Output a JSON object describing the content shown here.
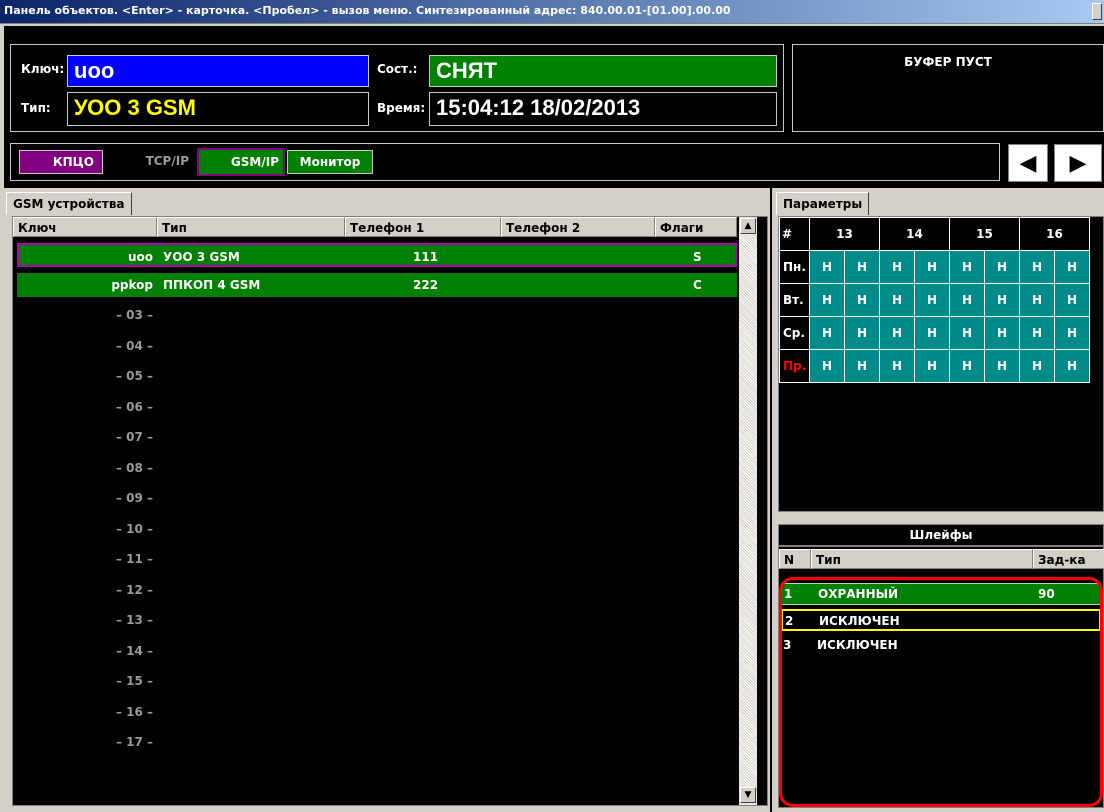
{
  "window": {
    "title": "Панель объектов. <Enter> - карточка. <Пробел> - вызов меню. Синтезированный адрес: 840.00.01-[01.00].00.00"
  },
  "header": {
    "key_label": "Ключ:",
    "key_value": "uoo",
    "type_label": "Тип:",
    "type_value": "УОО 3 GSM",
    "state_label": "Сост.:",
    "state_value": "СНЯТ",
    "time_label": "Время:",
    "time_value": "15:04:12 18/02/2013",
    "buffer_text": "БУФЕР ПУСТ"
  },
  "toolbar": {
    "buttons": [
      {
        "label": "КПЦО",
        "color": "#800080"
      },
      {
        "label": "TCP/IP",
        "color": "#000000"
      },
      {
        "label": "GSM/IP",
        "color": "#008000"
      },
      {
        "label": "Монитор",
        "color": "#008000"
      }
    ]
  },
  "devices": {
    "tab_label": "GSM устройства",
    "columns": [
      "Ключ",
      "Тип",
      "Телефон 1",
      "Телефон 2",
      "Флаги"
    ],
    "rows": [
      {
        "key": "uoo",
        "type": "УОО 3 GSM",
        "phone1": "111",
        "phone2": "",
        "flags": "S"
      },
      {
        "key": "ppkop",
        "type": "ППКОП 4 GSM",
        "phone1": "222",
        "phone2": "",
        "flags": "C"
      }
    ],
    "empty_rows": [
      "– 03 –",
      "– 04 –",
      "– 05 –",
      "– 06 –",
      "– 07 –",
      "– 08 –",
      "– 09 –",
      "– 10 –",
      "– 11 –",
      "– 12 –",
      "– 13 –",
      "– 14 –",
      "– 15 –",
      "– 16 –",
      "– 17 –"
    ]
  },
  "params": {
    "tab_label": "Параметры",
    "hash": "#",
    "columns": [
      "13",
      "14",
      "15",
      "16"
    ],
    "rows": [
      {
        "label": "Пн.",
        "cells": [
          "Н",
          "Н",
          "Н",
          "Н",
          "Н",
          "Н",
          "Н",
          "Н"
        ]
      },
      {
        "label": "Вт.",
        "cells": [
          "Н",
          "Н",
          "Н",
          "Н",
          "Н",
          "Н",
          "Н",
          "Н"
        ]
      },
      {
        "label": "Ср.",
        "cells": [
          "Н",
          "Н",
          "Н",
          "Н",
          "Н",
          "Н",
          "Н",
          "Н"
        ]
      },
      {
        "label": "Пр.",
        "cells": [
          "Н",
          "Н",
          "Н",
          "Н",
          "Н",
          "Н",
          "Н",
          "Н"
        ]
      }
    ]
  },
  "loops": {
    "title": "Шлейфы",
    "columns": [
      "N",
      "Тип",
      "Зад-ка"
    ],
    "rows": [
      {
        "n": "1",
        "type": "ОХРАННЫЙ",
        "delay": "90"
      },
      {
        "n": "2",
        "type": "ИСКЛЮЧЕН",
        "delay": ""
      },
      {
        "n": "3",
        "type": "ИСКЛЮЧЕН",
        "delay": ""
      }
    ]
  },
  "colors": {
    "key_field": "#0000ff",
    "state_field": "#008000",
    "type_value": "#ffff00",
    "row_selected": "#008000",
    "selection_outline": "#800080",
    "loops_outline": "#ff0000",
    "schedule_cell": "#008b8b",
    "holiday_label": "#ff0000"
  }
}
